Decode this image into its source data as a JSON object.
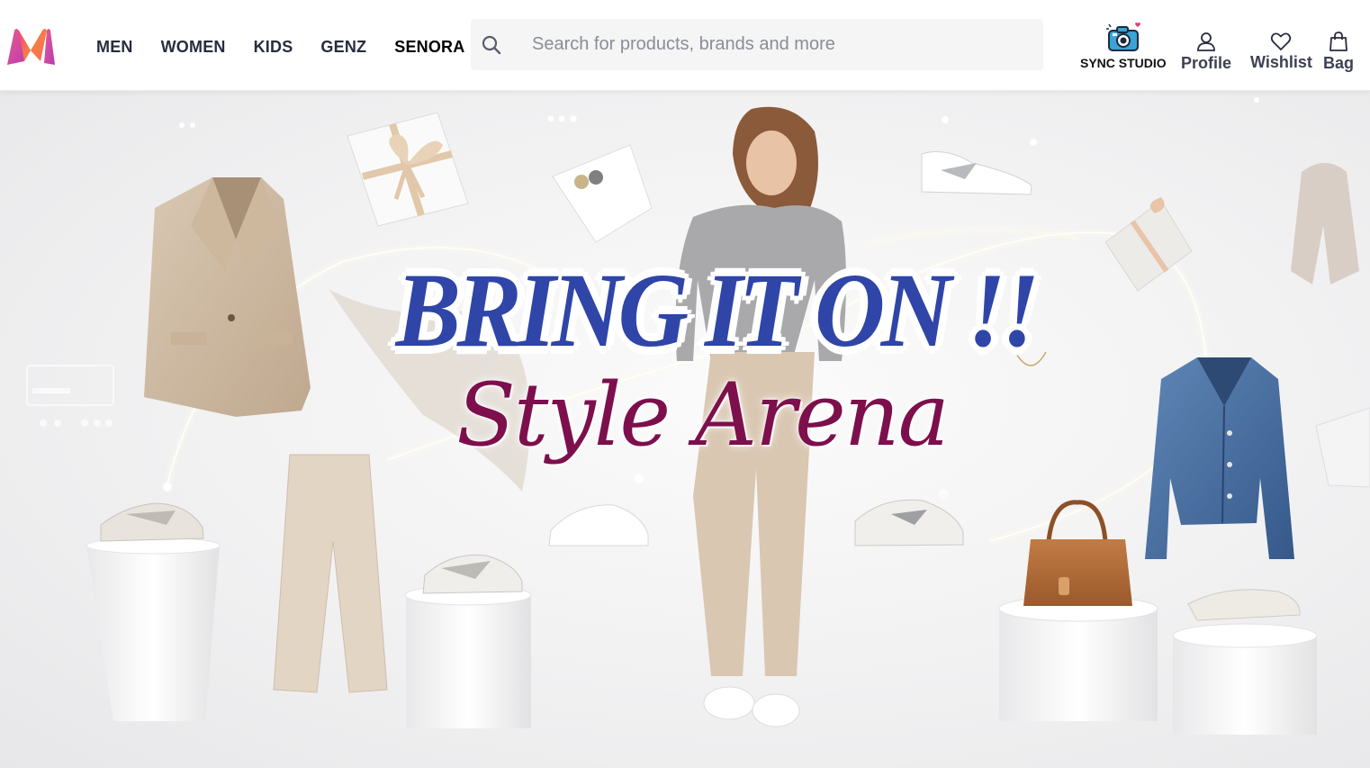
{
  "header": {
    "nav": [
      "MEN",
      "WOMEN",
      "KIDS",
      "GENZ",
      "SENORA"
    ],
    "search": {
      "placeholder": "Search for products, brands and more"
    },
    "actions": {
      "sync": "SYNC STUDIO",
      "profile": "Profile",
      "wishlist": "Wishlist",
      "bag": "Bag"
    }
  },
  "hero": {
    "headline": "BRING IT ON !!",
    "subline": "Style Arena"
  },
  "colors": {
    "headline": "#2f45a8",
    "subline": "#7d0f4c",
    "brand_gradient": [
      "#ff3f6c",
      "#f16565",
      "#e65c8d",
      "#b838b6"
    ]
  },
  "icons": [
    "myntra-logo",
    "search-icon",
    "camera-icon",
    "user-icon",
    "heart-icon",
    "bag-icon"
  ]
}
